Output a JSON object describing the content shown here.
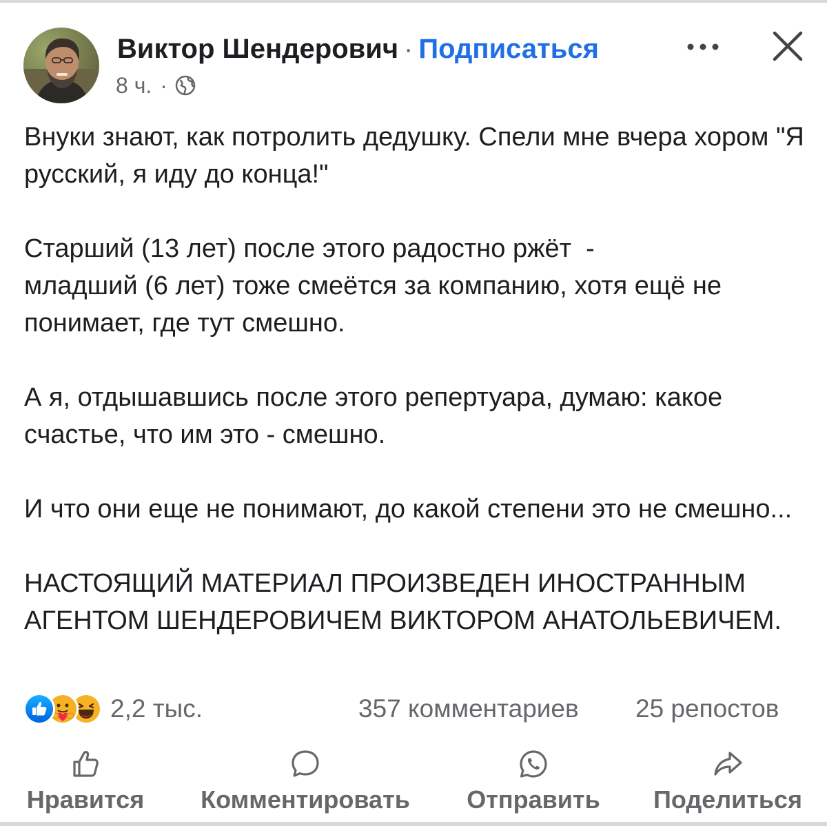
{
  "header": {
    "author_name": "Виктор Шендерович",
    "separator": "·",
    "subscribe_label": "Подписаться",
    "time": "8 ч.",
    "meta_separator": "·",
    "privacy_icon": "globe-icon",
    "more_icon": "more-horizontal-icon",
    "close_icon": "close-icon"
  },
  "post": {
    "paragraphs": [
      "Внуки знают, как потролить дедушку. Спели мне вчера хором \"Я русский, я иду до конца!\"",
      "Старший (13 лет) после этого радостно ржёт  -\nмладший (6 лет) тоже смеётся за компанию, хотя ещё не понимает, где тут смешно.",
      "А я, отдышавшись после этого репертуара, думаю: какое счастье, что им это - смешно.",
      "И что они еще не понимают, до какой степени это не смешно...",
      "НАСТОЯЩИЙ МАТЕРИАЛ ПРОИЗВЕДЕН ИНОСТРАННЫМ АГЕНТОМ ШЕНДЕРОВИЧЕМ ВИКТОРОМ АНАТОЛЬЕВИЧЕМ."
    ]
  },
  "stats": {
    "reactions": [
      "like-reaction-icon",
      "care-reaction-icon",
      "haha-reaction-icon"
    ],
    "reaction_count": "2,2 тыс.",
    "comments": "357 комментариев",
    "shares": "25 репостов"
  },
  "actions": {
    "like": "Нравится",
    "comment": "Комментировать",
    "send": "Отправить",
    "share": "Поделиться"
  },
  "colors": {
    "accent": "#1f6fe5",
    "text": "#1c1e21",
    "secondary_text": "#65676b",
    "divider": "#d9d9dc"
  }
}
